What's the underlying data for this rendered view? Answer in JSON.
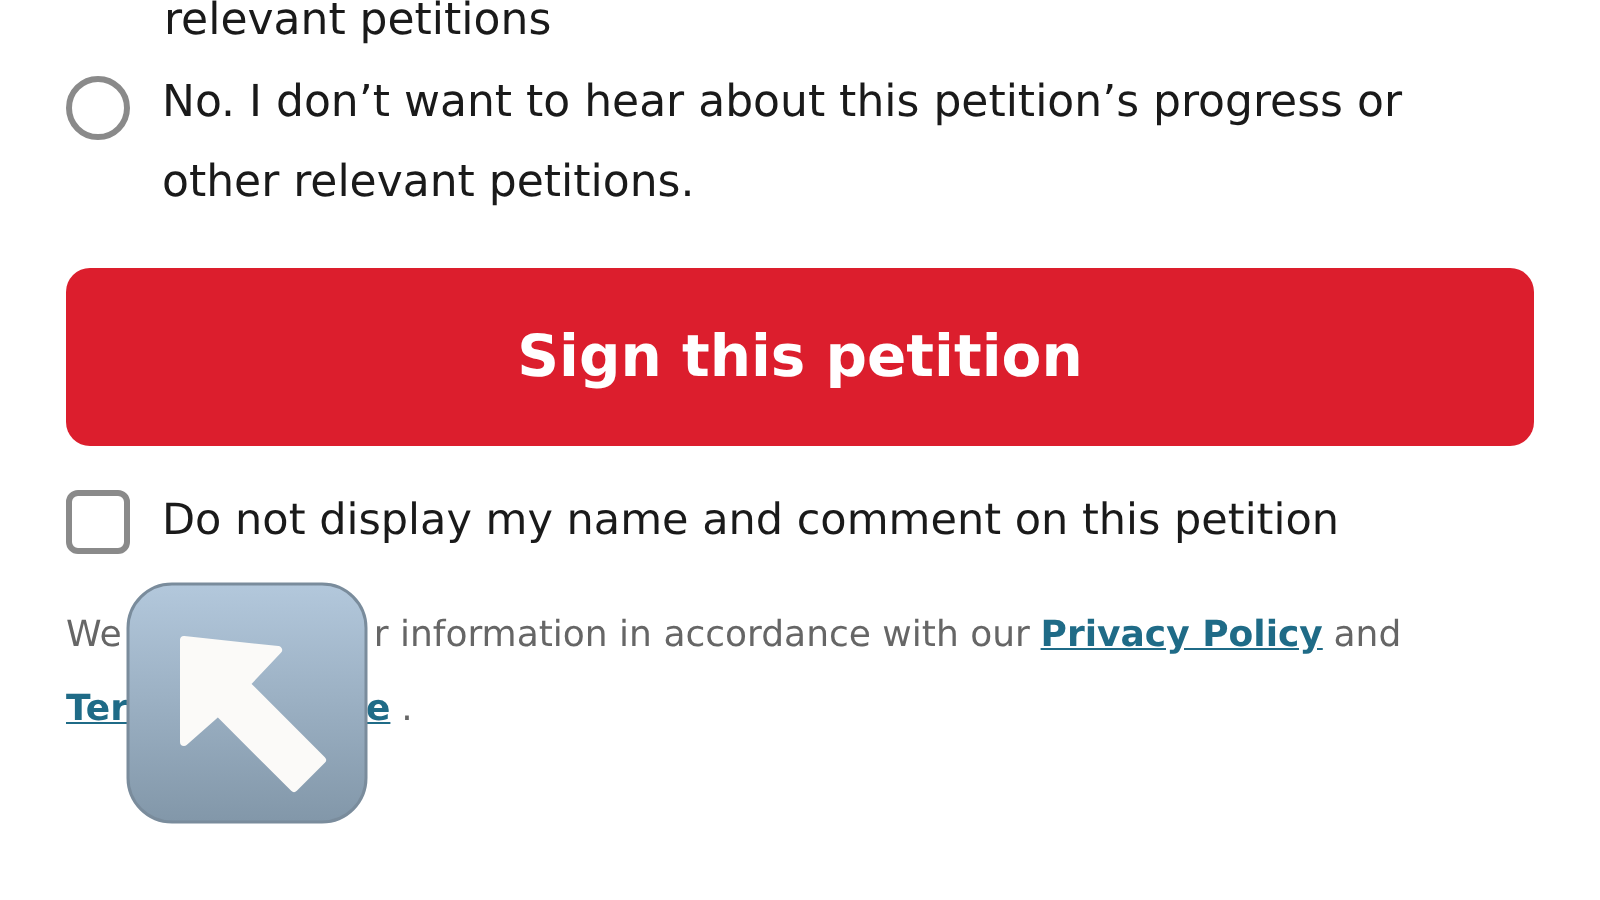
{
  "top_text": "relevant petitions",
  "options": [
    {
      "kind": "radio",
      "label": "No. I don’t want to hear about this petition’s progress or other relevant petitions.",
      "selected": false
    }
  ],
  "sign_button": "Sign this petition",
  "hide_name": {
    "label": "Do not display my name and comment on this petition",
    "checked": false
  },
  "notice_lines": [
    [
      [
        {
          "text": "We",
          "link": false
        }
      ],
      [
        {
          "text": "r information in accordance with our",
          "link": false
        },
        {
          "text": "Privacy Policy",
          "link": true
        },
        {
          "text": "and",
          "link": false
        }
      ]
    ],
    [
      [
        {
          "text": "Ter",
          "link": true
        }
      ],
      [
        {
          "text": "e",
          "link": true
        },
        {
          "text": ".",
          "link": false
        }
      ]
    ]
  ]
}
